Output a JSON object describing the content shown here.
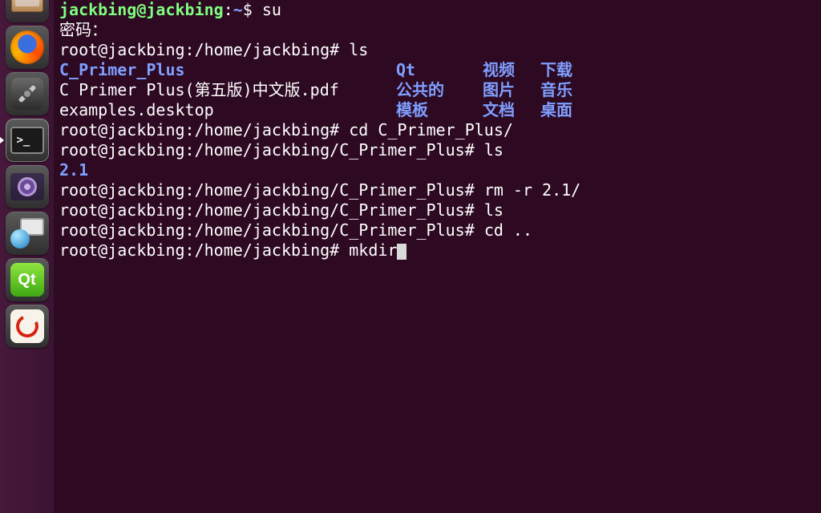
{
  "launcher": {
    "items": [
      {
        "name": "files",
        "interact": true
      },
      {
        "name": "firefox",
        "interact": true
      },
      {
        "name": "settings",
        "interact": true
      },
      {
        "name": "terminal",
        "interact": true,
        "active": true,
        "glyph": ">_"
      },
      {
        "name": "media-player",
        "interact": true
      },
      {
        "name": "remote-desktop",
        "interact": true
      },
      {
        "name": "qt-creator",
        "interact": true,
        "glyph": "Qt"
      },
      {
        "name": "pdf-reader",
        "interact": true
      }
    ]
  },
  "terminal": {
    "line0_user": "jackbing@jackbing",
    "line0_sep": ":",
    "line0_path": "~",
    "line0_prompt": "$ ",
    "line0_cmd": "su",
    "line1": "密码：",
    "line2_prompt": "root@jackbing:/home/jackbing# ",
    "line2_cmd": "ls",
    "ls1": {
      "c1": "C_Primer_Plus",
      "c2": "Qt",
      "c3": "视频",
      "c4": "下载",
      "r2c1": "C Primer Plus(第五版)中文版.pdf",
      "r2c2": "公共的",
      "r2c3": "图片",
      "r2c4": "音乐",
      "r3c1": "examples.desktop",
      "r3c2": "模板",
      "r3c3": "文档",
      "r3c4": "桌面"
    },
    "line6_prompt": "root@jackbing:/home/jackbing# ",
    "line6_cmd": "cd C_Primer_Plus/",
    "line7_prompt": "root@jackbing:/home/jackbing/C_Primer_Plus# ",
    "line7_cmd": "ls",
    "line8": "2.1",
    "line9_prompt": "root@jackbing:/home/jackbing/C_Primer_Plus# ",
    "line9_cmd": "rm -r 2.1/",
    "line10_prompt": "root@jackbing:/home/jackbing/C_Primer_Plus# ",
    "line10_cmd": "ls",
    "line11_prompt": "root@jackbing:/home/jackbing/C_Primer_Plus# ",
    "line11_cmd": "cd ..",
    "line12_prompt": "root@jackbing:/home/jackbing# ",
    "line12_cmd": "mkdir"
  }
}
